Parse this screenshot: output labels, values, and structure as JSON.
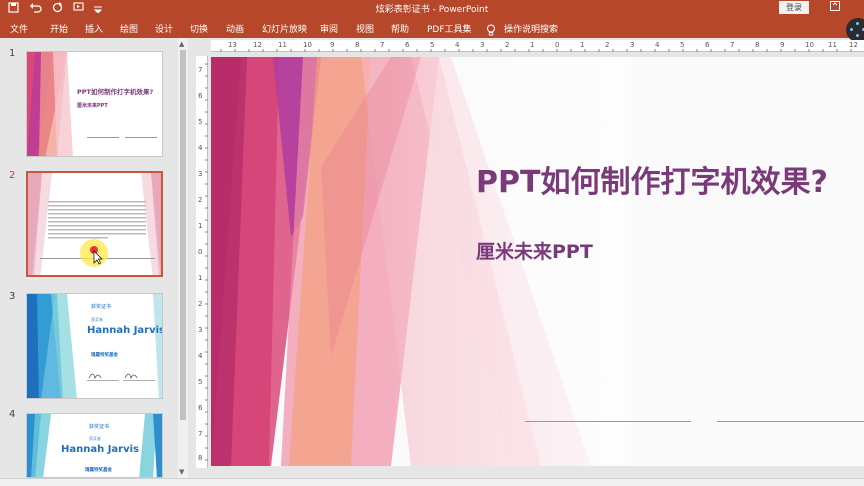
{
  "titlebar": {
    "title": "炫彩表彰证书 - PowerPoint",
    "signin": "登录",
    "qat_icons": [
      "save-icon",
      "undo-icon",
      "redo-icon",
      "start-from-beginning-icon",
      "customize-qat-icon"
    ],
    "window_buttons": [
      "ribbon-display-icon",
      "minimize-icon",
      "restore-icon",
      "close-icon"
    ]
  },
  "ribbon": {
    "tabs": [
      "文件",
      "开始",
      "插入",
      "绘图",
      "设计",
      "切换",
      "动画",
      "幻灯片放映",
      "审阅",
      "视图",
      "帮助",
      "PDF工具集"
    ],
    "tell_me": "操作说明搜索"
  },
  "thumbnails": [
    {
      "number": "1",
      "title": "PPT如何制作打字机效果?",
      "subtitle": "厘米未来PPT"
    },
    {
      "number": "2",
      "active": true
    },
    {
      "number": "3",
      "header": "获奖证书",
      "small": "获奖者",
      "name": "Hannah Jarvis",
      "footer": "瑰霞特奖基金"
    },
    {
      "number": "4",
      "header": "获奖证书",
      "small": "获奖者",
      "name": "Hannah Jarvis",
      "footer": "瑰霞特奖基金"
    }
  ],
  "ruler": {
    "horizontal": [
      "13",
      "12",
      "11",
      "10",
      "9",
      "8",
      "7",
      "6",
      "5",
      "4",
      "3",
      "2",
      "1",
      "0",
      "1",
      "2",
      "3",
      "4",
      "5",
      "6",
      "7",
      "8",
      "9",
      "10",
      "11",
      "12"
    ],
    "vertical": [
      "7",
      "6",
      "5",
      "4",
      "3",
      "2",
      "1",
      "0",
      "1",
      "2",
      "3",
      "4",
      "5",
      "6",
      "7",
      "8"
    ]
  },
  "slide": {
    "title": "PPT如何制作打字机效果?",
    "subtitle": "厘米未来PPT"
  },
  "colors": {
    "accent": "#b7472a",
    "title_text": "#7a3a7a",
    "magenta": "#c8336e",
    "pink": "#e98aa5",
    "coral": "#f08e6b",
    "blue": "#1f6fbf",
    "teal": "#4cc2c8"
  }
}
